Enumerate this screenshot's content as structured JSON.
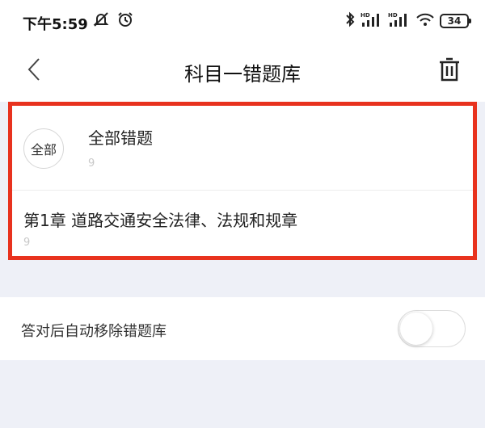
{
  "status_bar": {
    "time": "下午5:59",
    "battery": "34",
    "icons": [
      "mute-bell-icon",
      "alarm-icon",
      "bluetooth-icon",
      "signal-hd-icon",
      "signal-hd-icon",
      "wifi-icon",
      "battery-icon"
    ]
  },
  "nav": {
    "title": "科目一错题库",
    "back_icon": "chevron-left-icon",
    "trash_icon": "trash-icon"
  },
  "list": {
    "all": {
      "avatar_label": "全部",
      "title": "全部错题",
      "count": "9"
    },
    "chapters": [
      {
        "title": "第1章  道路交通安全法律、法规和规章",
        "count": "9"
      }
    ]
  },
  "setting": {
    "label": "答对后自动移除错题库",
    "toggle_on": false
  },
  "colors": {
    "highlight_border": "#e8321e",
    "page_bg": "#eef0f7"
  }
}
